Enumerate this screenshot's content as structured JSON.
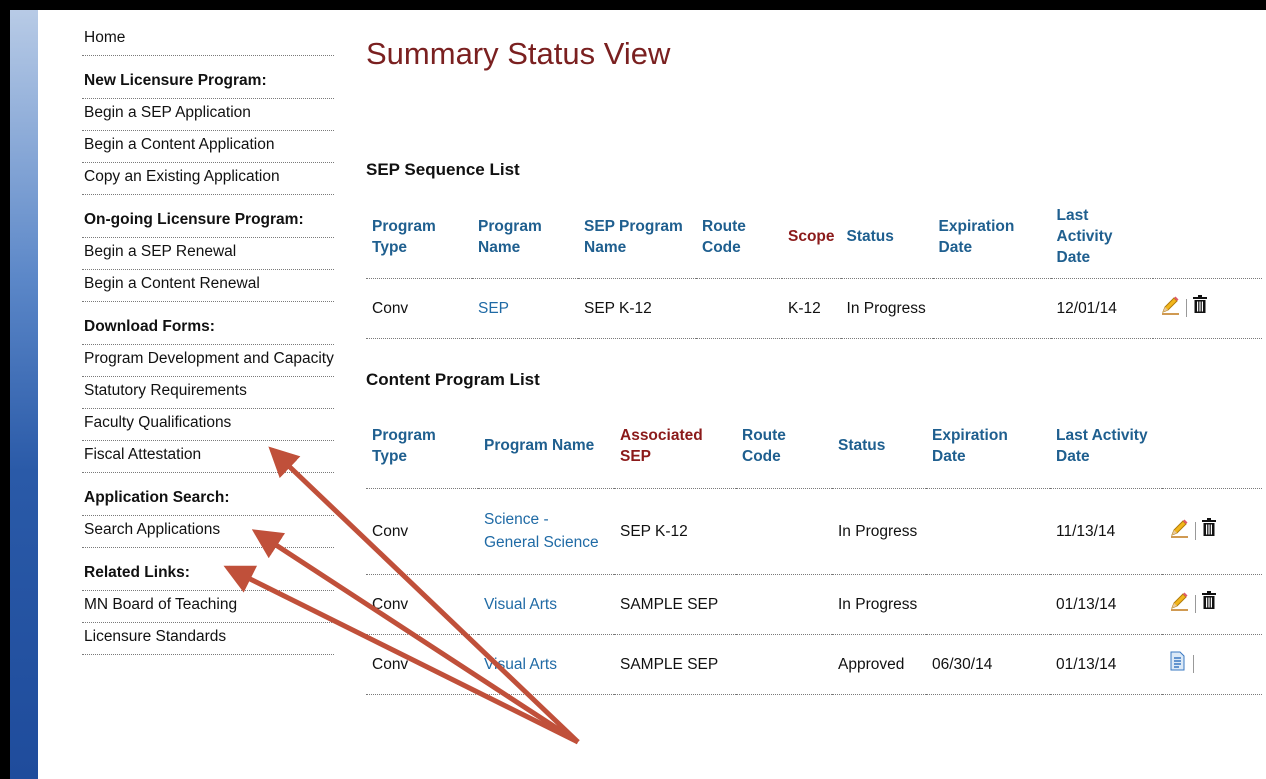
{
  "sidebar": {
    "items": [
      {
        "label": "Home",
        "type": "link"
      },
      {
        "label": "New Licensure Program:",
        "type": "heading"
      },
      {
        "label": "Begin a SEP Application",
        "type": "link"
      },
      {
        "label": "Begin a Content Application",
        "type": "link"
      },
      {
        "label": "Copy an Existing Application",
        "type": "link"
      },
      {
        "label": "On-going Licensure Program:",
        "type": "heading"
      },
      {
        "label": "Begin a SEP Renewal",
        "type": "link"
      },
      {
        "label": "Begin a Content Renewal",
        "type": "link"
      },
      {
        "label": "Download Forms:",
        "type": "heading"
      },
      {
        "label": "Program Development and Capacity",
        "type": "link"
      },
      {
        "label": "Statutory Requirements",
        "type": "link"
      },
      {
        "label": "Faculty Qualifications",
        "type": "link"
      },
      {
        "label": "Fiscal Attestation",
        "type": "link"
      },
      {
        "label": "Application Search:",
        "type": "heading"
      },
      {
        "label": "Search Applications",
        "type": "link"
      },
      {
        "label": "Related Links:",
        "type": "heading"
      },
      {
        "label": "MN Board of Teaching",
        "type": "link"
      },
      {
        "label": "Licensure Standards",
        "type": "link"
      }
    ]
  },
  "main": {
    "title": "Summary Status View",
    "sep_list": {
      "title": "SEP Sequence List",
      "headers": [
        "Program Type",
        "Program Name",
        "SEP Program Name",
        "Route Code",
        "Scope",
        "Status",
        "Expiration Date",
        "Last Activity Date"
      ],
      "rows": [
        {
          "program_type": "Conv",
          "program_name": "SEP",
          "sep_program_name": "SEP K-12",
          "route_code": "",
          "scope": "K-12",
          "status": "In Progress",
          "expiration_date": "",
          "last_activity": "12/01/14",
          "actions": [
            "edit-pencil-icon",
            "delete-trash-icon"
          ]
        }
      ]
    },
    "content_list": {
      "title": "Content Program List",
      "headers": [
        "Program Type",
        "Program Name",
        "Associated SEP",
        "Route Code",
        "Status",
        "Expiration Date",
        "Last Activity Date"
      ],
      "rows": [
        {
          "program_type": "Conv",
          "program_name": "Science - General Science",
          "associated_sep": "SEP K-12",
          "route_code": "",
          "status": "In Progress",
          "expiration_date": "",
          "last_activity": "11/13/14",
          "actions": [
            "edit-pencil-icon",
            "delete-trash-icon"
          ]
        },
        {
          "program_type": "Conv",
          "program_name": "Visual Arts",
          "associated_sep": "SAMPLE SEP",
          "route_code": "",
          "status": "In Progress",
          "expiration_date": "",
          "last_activity": "01/13/14",
          "actions": [
            "edit-pencil-icon",
            "delete-trash-icon"
          ]
        },
        {
          "program_type": "Conv",
          "program_name": "Visual Arts",
          "associated_sep": "SAMPLE SEP",
          "route_code": "",
          "status": "Approved",
          "expiration_date": "06/30/14",
          "last_activity": "01/13/14",
          "actions": [
            "view-document-icon"
          ]
        }
      ]
    }
  },
  "colors": {
    "title": "#7a2020",
    "header_blue": "#1f5f8f",
    "header_maroon": "#8b1a1a",
    "link": "#1f6aa5",
    "arrow": "#c0503a",
    "side_stripe": "#2a5aa8"
  }
}
